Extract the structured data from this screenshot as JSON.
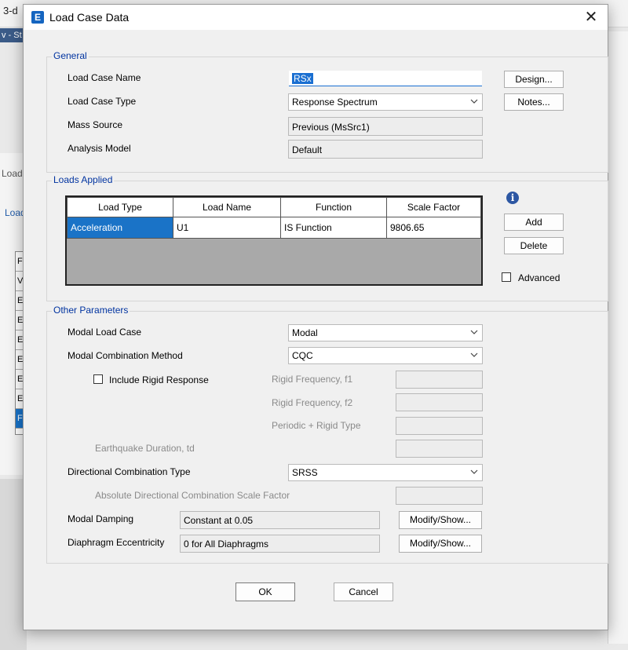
{
  "background": {
    "title": "3-d",
    "strip_text": "v - St",
    "left_label_1": "Load",
    "left_label_2": "Load",
    "list_letters": [
      "F",
      "V",
      "E",
      "E",
      "E",
      "E",
      "E",
      "E",
      "F"
    ]
  },
  "dialog": {
    "icon_letter": "E",
    "title": "Load Case Data",
    "close_glyph": "✕"
  },
  "general": {
    "title": "General",
    "name_label": "Load Case Name",
    "name_value": "RSx",
    "type_label": "Load Case Type",
    "type_value": "Response Spectrum",
    "mass_label": "Mass Source",
    "mass_value": "Previous  (MsSrc1)",
    "model_label": "Analysis Model",
    "model_value": "Default",
    "design_button": "Design...",
    "notes_button": "Notes..."
  },
  "loads_applied": {
    "title": "Loads Applied",
    "columns": [
      "Load Type",
      "Load Name",
      "Function",
      "Scale Factor"
    ],
    "rows": [
      [
        "Acceleration",
        "U1",
        "IS Function",
        "9806.65"
      ]
    ],
    "info_glyph": "i",
    "add_button": "Add",
    "delete_button": "Delete",
    "advanced_label": "Advanced"
  },
  "other": {
    "title": "Other Parameters",
    "modal_case_label": "Modal Load Case",
    "modal_case_value": "Modal",
    "modal_comb_label": "Modal Combination Method",
    "modal_comb_value": "CQC",
    "rigid_response_label": "Include Rigid Response",
    "rigid_f1_label": "Rigid Frequency, f1",
    "rigid_f2_label": "Rigid Frequency, f2",
    "periodic_label": "Periodic + Rigid Type",
    "eq_duration_label": "Earthquake Duration, td",
    "dir_comb_label": "Directional Combination Type",
    "dir_comb_value": "SRSS",
    "abs_dir_label": "Absolute Directional Combination Scale Factor",
    "modal_damping_label": "Modal Damping",
    "modal_damping_value": "Constant at 0.05",
    "diaphragm_label": "Diaphragm Eccentricity",
    "diaphragm_value": "0 for All Diaphragms",
    "modify_button_1": "Modify/Show...",
    "modify_button_2": "Modify/Show..."
  },
  "footer": {
    "ok_button": "OK",
    "cancel_button": "Cancel"
  },
  "colors": {
    "accent": "#1a6fd1",
    "group_title": "#0033a0",
    "grid_fill": "#a9a9a9"
  }
}
